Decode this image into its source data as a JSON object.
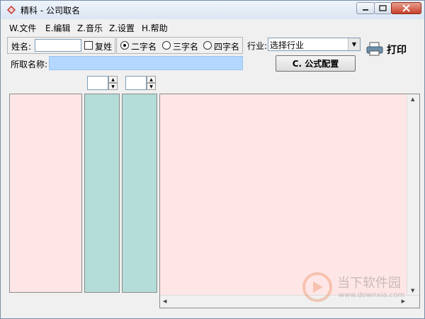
{
  "window": {
    "title": "精科 - 公司取名"
  },
  "menu": {
    "items": [
      "W.文件",
      "E.编辑",
      "Z.音乐",
      "Z.设置",
      "H.帮助"
    ]
  },
  "form": {
    "surname_label": "姓名:",
    "surname_value": "",
    "compound_label": "复姓",
    "name_options": [
      "二字名",
      "三字名",
      "四字名"
    ],
    "selected_name_option": "二字名",
    "industry_label": "行业:",
    "industry_value": "选择行业",
    "print_label": "打印",
    "result_label": "所取名称:",
    "result_value": "",
    "formula_button": "C. 公式配置"
  },
  "spinners": {
    "first": "",
    "second": ""
  },
  "watermark": {
    "brand": "当下软件园",
    "url": "www.downxia.com"
  },
  "colors": {
    "pink": "#ffe6e6",
    "teal": "#b4dcd8",
    "result_bg": "#b3d7ff"
  }
}
